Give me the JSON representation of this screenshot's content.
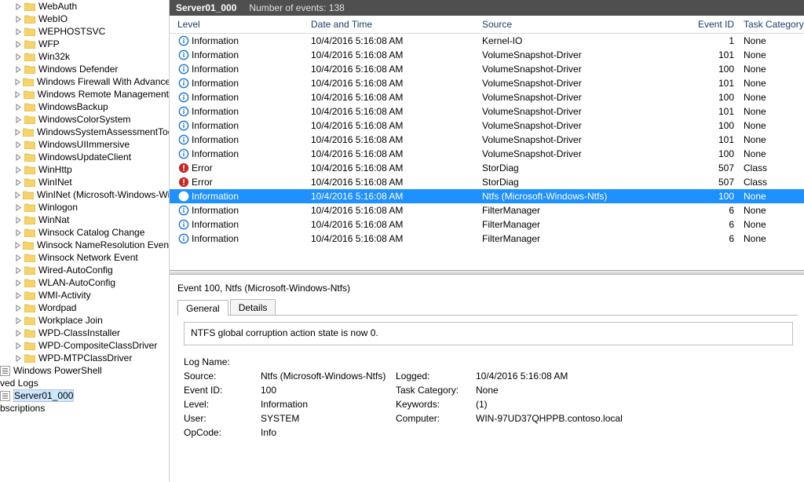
{
  "tree": {
    "nodes": [
      {
        "label": "WebAuth",
        "kind": "folder",
        "expandable": true
      },
      {
        "label": "WebIO",
        "kind": "folder",
        "expandable": true
      },
      {
        "label": "WEPHOSTSVC",
        "kind": "folder",
        "expandable": true
      },
      {
        "label": "WFP",
        "kind": "folder",
        "expandable": true
      },
      {
        "label": "Win32k",
        "kind": "folder",
        "expandable": true
      },
      {
        "label": "Windows Defender",
        "kind": "folder",
        "expandable": true
      },
      {
        "label": "Windows Firewall With Advanced Security",
        "kind": "folder",
        "expandable": true
      },
      {
        "label": "Windows Remote Management",
        "kind": "folder",
        "expandable": true
      },
      {
        "label": "WindowsBackup",
        "kind": "folder",
        "expandable": true
      },
      {
        "label": "WindowsColorSystem",
        "kind": "folder",
        "expandable": true
      },
      {
        "label": "WindowsSystemAssessmentTool",
        "kind": "folder",
        "expandable": true
      },
      {
        "label": "WindowsUIImmersive",
        "kind": "folder",
        "expandable": true
      },
      {
        "label": "WindowsUpdateClient",
        "kind": "folder",
        "expandable": true
      },
      {
        "label": "WinHttp",
        "kind": "folder",
        "expandable": true
      },
      {
        "label": "WinINet",
        "kind": "folder",
        "expandable": true
      },
      {
        "label": "WinINet (Microsoft-Windows-WinINet)",
        "kind": "folder",
        "expandable": true
      },
      {
        "label": "Winlogon",
        "kind": "folder",
        "expandable": true
      },
      {
        "label": "WinNat",
        "kind": "folder",
        "expandable": true
      },
      {
        "label": "Winsock Catalog Change",
        "kind": "folder",
        "expandable": true
      },
      {
        "label": "Winsock NameResolution Event",
        "kind": "folder",
        "expandable": true
      },
      {
        "label": "Winsock Network Event",
        "kind": "folder",
        "expandable": true
      },
      {
        "label": "Wired-AutoConfig",
        "kind": "folder",
        "expandable": true
      },
      {
        "label": "WLAN-AutoConfig",
        "kind": "folder",
        "expandable": true
      },
      {
        "label": "WMI-Activity",
        "kind": "folder",
        "expandable": true
      },
      {
        "label": "Wordpad",
        "kind": "folder",
        "expandable": true
      },
      {
        "label": "Workplace Join",
        "kind": "folder",
        "expandable": true
      },
      {
        "label": "WPD-ClassInstaller",
        "kind": "folder",
        "expandable": true
      },
      {
        "label": "WPD-CompositeClassDriver",
        "kind": "folder",
        "expandable": true
      },
      {
        "label": "WPD-MTPClassDriver",
        "kind": "folder",
        "expandable": true
      }
    ],
    "roots": [
      {
        "label": "Windows PowerShell",
        "kind": "log",
        "selected": false
      },
      {
        "label": "ved Logs",
        "kind": "text",
        "selected": false
      },
      {
        "label": "Server01_000",
        "kind": "log",
        "selected": true
      },
      {
        "label": "bscriptions",
        "kind": "text",
        "selected": false
      }
    ]
  },
  "header": {
    "title": "Server01_000",
    "subtitle": "Number of events: 138"
  },
  "events": {
    "columns": {
      "level": "Level",
      "date": "Date and Time",
      "source": "Source",
      "id": "Event ID",
      "task": "Task Category"
    },
    "rows": [
      {
        "level": "Information",
        "date": "10/4/2016 5:16:08 AM",
        "source": "Kernel-IO",
        "id": "1",
        "task": "None",
        "icon": "info"
      },
      {
        "level": "Information",
        "date": "10/4/2016 5:16:08 AM",
        "source": "VolumeSnapshot-Driver",
        "id": "101",
        "task": "None",
        "icon": "info"
      },
      {
        "level": "Information",
        "date": "10/4/2016 5:16:08 AM",
        "source": "VolumeSnapshot-Driver",
        "id": "100",
        "task": "None",
        "icon": "info"
      },
      {
        "level": "Information",
        "date": "10/4/2016 5:16:08 AM",
        "source": "VolumeSnapshot-Driver",
        "id": "101",
        "task": "None",
        "icon": "info"
      },
      {
        "level": "Information",
        "date": "10/4/2016 5:16:08 AM",
        "source": "VolumeSnapshot-Driver",
        "id": "100",
        "task": "None",
        "icon": "info"
      },
      {
        "level": "Information",
        "date": "10/4/2016 5:16:08 AM",
        "source": "VolumeSnapshot-Driver",
        "id": "101",
        "task": "None",
        "icon": "info"
      },
      {
        "level": "Information",
        "date": "10/4/2016 5:16:08 AM",
        "source": "VolumeSnapshot-Driver",
        "id": "100",
        "task": "None",
        "icon": "info"
      },
      {
        "level": "Information",
        "date": "10/4/2016 5:16:08 AM",
        "source": "VolumeSnapshot-Driver",
        "id": "101",
        "task": "None",
        "icon": "info"
      },
      {
        "level": "Information",
        "date": "10/4/2016 5:16:08 AM",
        "source": "VolumeSnapshot-Driver",
        "id": "100",
        "task": "None",
        "icon": "info"
      },
      {
        "level": "Error",
        "date": "10/4/2016 5:16:08 AM",
        "source": "StorDiag",
        "id": "507",
        "task": "Class",
        "icon": "error"
      },
      {
        "level": "Error",
        "date": "10/4/2016 5:16:08 AM",
        "source": "StorDiag",
        "id": "507",
        "task": "Class",
        "icon": "error"
      },
      {
        "level": "Information",
        "date": "10/4/2016 5:16:08 AM",
        "source": "Ntfs (Microsoft-Windows-Ntfs)",
        "id": "100",
        "task": "None",
        "icon": "info",
        "selected": true
      },
      {
        "level": "Information",
        "date": "10/4/2016 5:16:08 AM",
        "source": "FilterManager",
        "id": "6",
        "task": "None",
        "icon": "info"
      },
      {
        "level": "Information",
        "date": "10/4/2016 5:16:08 AM",
        "source": "FilterManager",
        "id": "6",
        "task": "None",
        "icon": "info"
      },
      {
        "level": "Information",
        "date": "10/4/2016 5:16:08 AM",
        "source": "FilterManager",
        "id": "6",
        "task": "None",
        "icon": "info"
      }
    ]
  },
  "details": {
    "title": "Event 100, Ntfs (Microsoft-Windows-Ntfs)",
    "tabs": {
      "general": "General",
      "details": "Details"
    },
    "message": "NTFS global corruption action state is now 0.",
    "props": {
      "log_name_k": "Log Name:",
      "source_k": "Source:",
      "source_v": "Ntfs (Microsoft-Windows-Ntfs)",
      "logged_k": "Logged:",
      "logged_v": "10/4/2016 5:16:08 AM",
      "eventid_k": "Event ID:",
      "eventid_v": "100",
      "taskcat_k": "Task Category:",
      "taskcat_v": "None",
      "level_k": "Level:",
      "level_v": "Information",
      "keywords_k": "Keywords:",
      "keywords_v": "(1)",
      "user_k": "User:",
      "user_v": "SYSTEM",
      "computer_k": "Computer:",
      "computer_v": "WIN-97UD37QHPPB.contoso.local",
      "opcode_k": "OpCode:",
      "opcode_v": "Info"
    }
  }
}
